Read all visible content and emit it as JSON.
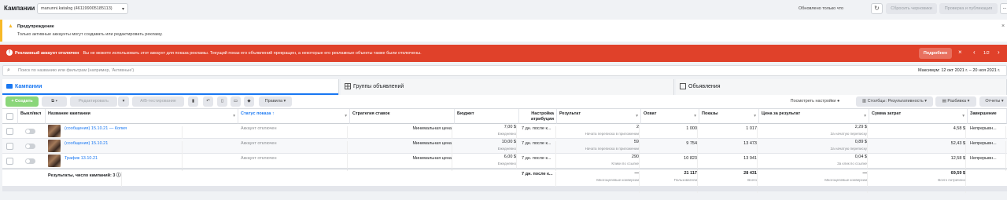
{
  "header": {
    "title": "Кампании",
    "account": "manunni.katalog (461199005185113)",
    "updated": "Обновлено только что",
    "discard_label": "Сбросить черновики",
    "review_label": "Проверка и публикация",
    "more_label": "..."
  },
  "warning": {
    "title": "Предупреждение",
    "text": "Только активные аккаунты могут создавать или редактировать рекламу."
  },
  "error": {
    "title": "Рекламный аккаунт отключен",
    "text": "Вы не можете использовать этот аккаунт для показа рекламы. Текущий показ его объявлений прекращен, а некоторые его рекламные объекты также были отключены.",
    "more_label": "Подробнее",
    "pager": "1/2"
  },
  "search": {
    "placeholder": "Поиск по названию или фильтрам (например, 'Активные')",
    "date_range": "Максимум: 12 окт 2021 г. – 20 ноя 2021 г."
  },
  "tabs": [
    {
      "label": "Кампании"
    },
    {
      "label": "Группы объявлений"
    },
    {
      "label": "Объявления"
    }
  ],
  "toolbar": {
    "create": "+ Создать",
    "edit": "Редактировать",
    "ab_test": "А/B-тестирование",
    "rules": "Правила",
    "view_settings": "Посмотреть настройки",
    "columns": "Столбцы: Результативность",
    "breakdown": "Разбивка",
    "reports": "Отчеты"
  },
  "columns": {
    "onoff": "Выкл/вкл",
    "name": "Название кампании",
    "status": "Статус показа ↑",
    "bid": "Стратегия ставок",
    "budget": "Бюджет",
    "attrib": "Настройка атрибуции",
    "result": "Результат",
    "reach": "Охват",
    "impr": "Показы",
    "cpr": "Цена за результат",
    "spend": "Сумма затрат",
    "end": "Завершение"
  },
  "rows": [
    {
      "name": "(сообщения) 15.10.21 — Копия",
      "status": "Аккаунт отключен",
      "bid": "Минимальная цена",
      "budget": "7,00 $",
      "budget_sub": "Ежедневно",
      "attrib": "7 дн. после к...",
      "result": "2",
      "result_sub": "Начата переписка в приложении",
      "reach": "1 000",
      "impr": "1 017",
      "cpr": "2,29 $",
      "cpr_sub": "За начатую переписку",
      "spend": "4,58 $",
      "end": "Непрерывн..."
    },
    {
      "name": "(сообщения) 15.10.21",
      "status": "Аккаунт отключен",
      "bid": "Минимальная цена",
      "budget": "10,00 $",
      "budget_sub": "Ежедневно",
      "attrib": "7 дн. после к...",
      "result": "59",
      "result_sub": "Начата переписка в приложении",
      "reach": "9 754",
      "impr": "13 473",
      "cpr": "0,89 $",
      "cpr_sub": "За начатую переписку",
      "spend": "52,43 $",
      "end": "Непрерывн..."
    },
    {
      "name": "Трафик 13.10.21",
      "status": "Аккаунт отключен",
      "bid": "Минимальная цена",
      "budget": "6,00 $",
      "budget_sub": "Ежедневно",
      "attrib": "7 дн. после к...",
      "result": "290",
      "result_sub": "Клики по ссылке",
      "reach": "10 823",
      "impr": "13 941",
      "cpr": "0,04 $",
      "cpr_sub": "За клик по ссылке",
      "spend": "12,58 $",
      "end": "Непрерывн..."
    }
  ],
  "totals": {
    "label": "Результаты, число кампаний: 3",
    "attrib": "7 дн. после к...",
    "result": "—",
    "result_sub": "Многоцелевые конверсии",
    "reach": "21 117",
    "reach_sub": "Пользователи",
    "impr": "28 431",
    "impr_sub": "Всего",
    "cpr": "—",
    "cpr_sub": "Многоцелевые конверсии",
    "spend": "69,59 $",
    "spend_sub": "Всего потрачено"
  }
}
